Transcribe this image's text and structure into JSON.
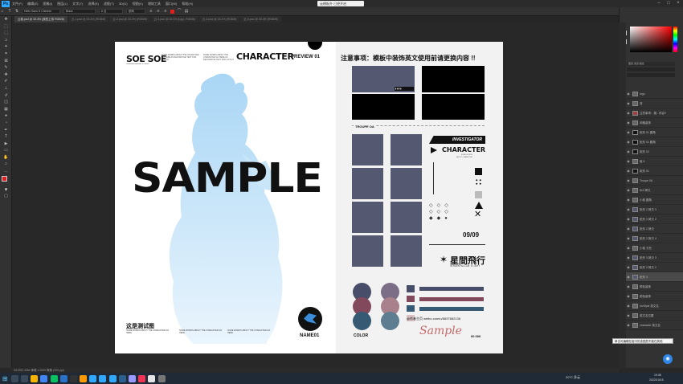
{
  "menubar": {
    "app_logo": "Ps",
    "items": [
      "文件(F)",
      "编辑(E)",
      "图像(I)",
      "图层(L)",
      "文字(Y)",
      "选择(S)",
      "滤镜(T)",
      "3D(D)",
      "视图(V)",
      "增效工具",
      "窗口(W)",
      "帮助(H)"
    ],
    "notice": "云模板升 已经开启"
  },
  "options": {
    "font_family": "Hello Sans S Chinese",
    "font_style": "Black",
    "font_size": "6 点",
    "antialias": "锐利",
    "leading": "自动"
  },
  "tabs": [
    {
      "label": "云卷.psd @ 33.3% (我的上传 RGB/8)",
      "active": true
    },
    {
      "label": "云-1.psd @ 33.3% (RGB/8)",
      "active": false
    },
    {
      "label": "云-2.psd @ 33.3% (RGB/8)",
      "active": false
    },
    {
      "label": "云-3.psd @ 33.3% (logo, RGB/8)",
      "active": false
    },
    {
      "label": "云-4.psd @ 33.3% (RGB/8)",
      "active": false
    },
    {
      "label": "云-5.psd @ 33.3% (RGB/8)",
      "active": false
    }
  ],
  "left_page": {
    "logo": "SOE SOE",
    "logo_small": "SOESOE DESIGN STUDIO",
    "small_text": "SOME WORDS ABOUT THE CHARACTER GO HERE AS DECORATIVE TEXT FOR LAYOUT",
    "title": "CHARACTER",
    "title_suffix": "PREVIEW 01",
    "watermark": "SAMPLE",
    "caption": "这是测试图",
    "caption_text_1": "SOME WORDS ABOUT THE CHARACTER GO HERE",
    "caption_text_2": "SOME WORDS ABOUT THE CHARACTER GO HERE",
    "caption_text_3": "SOME WORDS ABOUT THE CHARACTER GO HERE",
    "name_label": "NAME01"
  },
  "right_page": {
    "notice": "注意事项：模板中装饰英文使用前请更换内容 !!",
    "troupe_label": "TROUPE OA",
    "investigator": "INVESTIGATOR",
    "character": "CHARACTER",
    "date": "09/09",
    "brand_cn": "星間飛行",
    "brand_en": "INTERSTELLAR FLIGHT",
    "color_label": "COLOR",
    "contact": "@作者主页 weibo.com/u/5637682136",
    "signature": "Sample",
    "dots": "00 000",
    "swatch_colors": [
      "#484e6a",
      "#7b6e86",
      "#81495b",
      "#a9818d",
      "#365a73",
      "#5e7d91"
    ]
  },
  "layers_panel": {
    "rows": [
      {
        "name": "logo",
        "selected": false
      },
      {
        "name": "背",
        "selected": false
      },
      {
        "name": "注意事项：模...内容!!",
        "selected": false
      },
      {
        "name": "网格装饰",
        "selected": false
      },
      {
        "name": "矩形 01 圆角",
        "selected": false
      },
      {
        "name": "矩形 02 圆角",
        "selected": false
      },
      {
        "name": "矩形 02",
        "selected": false
      },
      {
        "name": "组 6",
        "selected": false
      },
      {
        "name": "矩形 01",
        "selected": false
      },
      {
        "name": "Troupe 0A",
        "selected": false
      },
      {
        "name": "8x3 拷贝",
        "selected": false
      },
      {
        "name": "小卷 圆角",
        "selected": false
      },
      {
        "name": "矩形 2 拷贝 3",
        "selected": false
      },
      {
        "name": "矩形 2 拷贝 2",
        "selected": false
      },
      {
        "name": "矩形 2 拷贝",
        "selected": false
      },
      {
        "name": "矩形 2 拷贝 4",
        "selected": false
      },
      {
        "name": "小卷 方形",
        "selected": false
      },
      {
        "name": "矩形 3 拷贝 3",
        "selected": false
      },
      {
        "name": "矩形 3 拷贝 2",
        "selected": false
      },
      {
        "name": "矩形 3",
        "selected": true
      },
      {
        "name": "颜色装饰",
        "selected": false
      },
      {
        "name": "颜色装饰",
        "selected": false
      },
      {
        "name": "InvStyle 英文名",
        "selected": false
      },
      {
        "name": "英文名位置",
        "selected": false
      },
      {
        "name": "character 英文名",
        "selected": false
      }
    ],
    "tooltip": "单击可编辑在组中的该图层不能在其他"
  },
  "statusbar": {
    "text": "33.33%   4264 像素 x 2000 像素 (300 ppi)"
  },
  "taskbar": {
    "weather": "20°C 多云",
    "time": "19:38",
    "date": "2022/10/15"
  },
  "colors": {
    "accent": "#31a8ff",
    "grid_tile": "#545870",
    "foreground_swatch": "#e02020"
  }
}
